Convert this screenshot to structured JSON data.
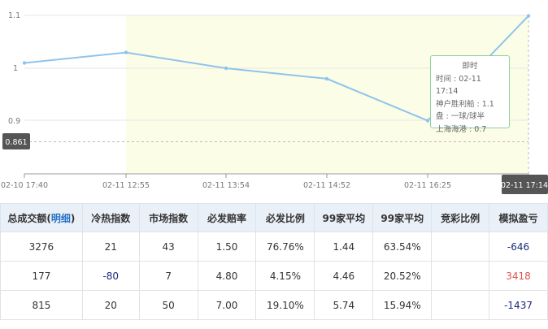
{
  "chart_data": {
    "type": "line",
    "x": [
      "02-10 17:40",
      "02-11 12:55",
      "02-11 13:54",
      "02-11 14:52",
      "02-11 16:25",
      "02-11 17:14"
    ],
    "series": [
      {
        "values": [
          1.01,
          1.03,
          1.0,
          0.98,
          0.9,
          1.1
        ]
      }
    ],
    "yticks": [
      "1.1",
      "1",
      "0.9"
    ],
    "ylim": [
      0.82,
      1.1
    ],
    "marker_value": "0.861",
    "highlight_x_label": "02-11 17:14",
    "line_color": "#8ec4ec",
    "band_color": "#fcfde6"
  },
  "tooltip": {
    "title": "即时",
    "time": "时间 : 02-11 17:14",
    "line1": "神户胜利船 : 1.1",
    "line2": "盘 : 一球/球半",
    "line3": "上海海港 : 0.7"
  },
  "table": {
    "headers": [
      "冷热指数",
      "市场指数",
      "必发赔率",
      "必发比例",
      "99家平均",
      "99家平均",
      "竞彩比例",
      "模拟盈亏"
    ],
    "first_header_prefix": "总成交额(",
    "first_header_link": "明细",
    "first_header_suffix": ")",
    "rows": [
      [
        "3276",
        "21",
        "43",
        "1.50",
        "76.76%",
        "1.44",
        "63.54%",
        "",
        "-646"
      ],
      [
        "177",
        "-80",
        "7",
        "4.80",
        "4.15%",
        "4.46",
        "20.52%",
        "",
        "3418"
      ],
      [
        "815",
        "20",
        "50",
        "7.00",
        "19.10%",
        "5.74",
        "15.94%",
        "",
        "-1437"
      ]
    ]
  }
}
